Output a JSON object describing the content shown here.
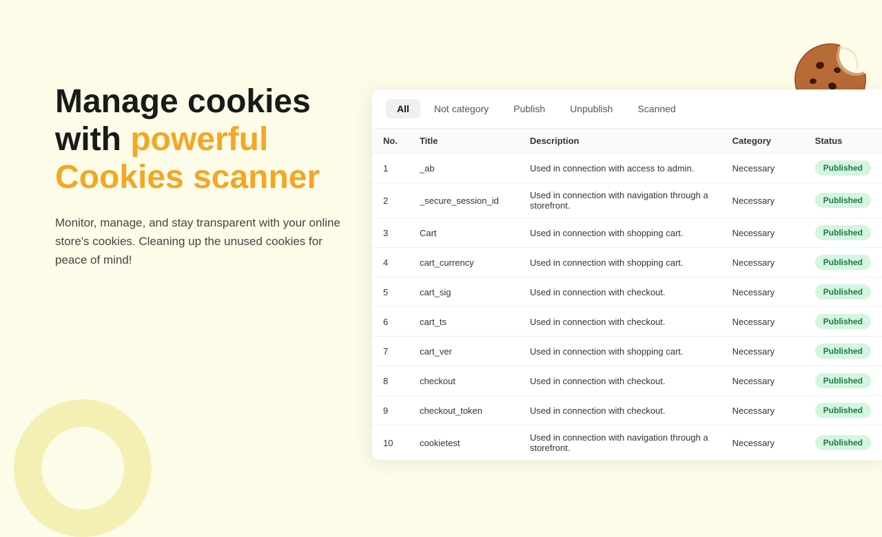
{
  "background": {
    "color": "#fdfce8"
  },
  "left": {
    "headline_part1": "Manage cookies",
    "headline_part2": "with ",
    "headline_highlight": "powerful",
    "headline_part3": "Cookies scanner",
    "description": "Monitor, manage, and stay transparent with your online store's cookies. Cleaning up the unused cookies for peace of mind!"
  },
  "tabs": {
    "items": [
      {
        "label": "All",
        "active": true
      },
      {
        "label": "Not category",
        "active": false
      },
      {
        "label": "Publish",
        "active": false
      },
      {
        "label": "Unpublish",
        "active": false
      },
      {
        "label": "Scanned",
        "active": false
      }
    ]
  },
  "table": {
    "columns": [
      {
        "key": "no",
        "label": "No."
      },
      {
        "key": "title",
        "label": "Title"
      },
      {
        "key": "description",
        "label": "Description"
      },
      {
        "key": "category",
        "label": "Category"
      },
      {
        "key": "status",
        "label": "Status"
      }
    ],
    "rows": [
      {
        "no": 1,
        "title": "_ab",
        "description": "Used in connection with access to admin.",
        "category": "Necessary",
        "status": "Published"
      },
      {
        "no": 2,
        "title": "_secure_session_id",
        "description": "Used in connection with navigation through a storefront.",
        "category": "Necessary",
        "status": "Published"
      },
      {
        "no": 3,
        "title": "Cart",
        "description": "Used in connection with shopping cart.",
        "category": "Necessary",
        "status": "Published"
      },
      {
        "no": 4,
        "title": "cart_currency",
        "description": "Used in connection with shopping cart.",
        "category": "Necessary",
        "status": "Published"
      },
      {
        "no": 5,
        "title": "cart_sig",
        "description": "Used in connection with checkout.",
        "category": "Necessary",
        "status": "Published"
      },
      {
        "no": 6,
        "title": "cart_ts",
        "description": "Used in connection with checkout.",
        "category": "Necessary",
        "status": "Published"
      },
      {
        "no": 7,
        "title": "cart_ver",
        "description": "Used in connection with shopping cart.",
        "category": "Necessary",
        "status": "Published"
      },
      {
        "no": 8,
        "title": "checkout",
        "description": "Used in connection with checkout.",
        "category": "Necessary",
        "status": "Published"
      },
      {
        "no": 9,
        "title": "checkout_token",
        "description": "Used in connection with checkout.",
        "category": "Necessary",
        "status": "Published"
      },
      {
        "no": 10,
        "title": "cookietest",
        "description": "Used in connection with navigation through a storefront.",
        "category": "Necessary",
        "status": "Published"
      }
    ]
  },
  "cookie_icon": {
    "alt": "Cookie icon"
  }
}
